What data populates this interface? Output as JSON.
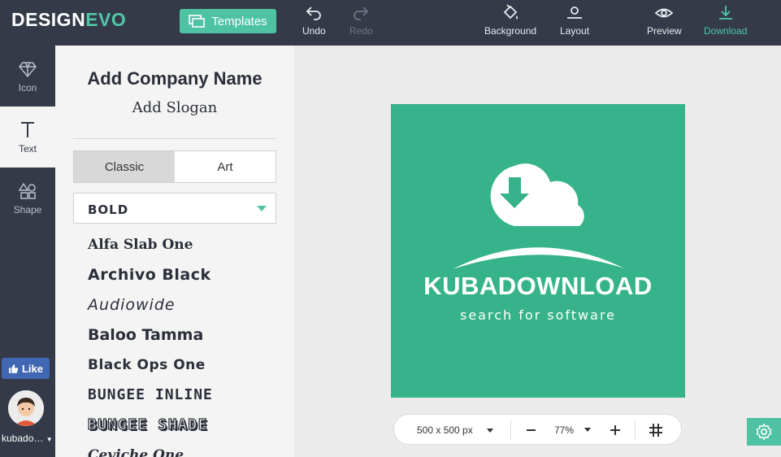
{
  "app": {
    "logo_main": "DESIGN",
    "logo_accent": "EVO"
  },
  "toolbar": {
    "templates_label": "Templates",
    "undo_label": "Undo",
    "redo_label": "Redo",
    "background_label": "Background",
    "layout_label": "Layout",
    "preview_label": "Preview",
    "download_label": "Download"
  },
  "sidebar": {
    "items": [
      {
        "label": "Icon",
        "icon": "diamond-icon"
      },
      {
        "label": "Text",
        "icon": "text-icon"
      },
      {
        "label": "Shape",
        "icon": "shapes-icon"
      }
    ],
    "active": "Text",
    "like_label": "Like",
    "user_name": "kubado…"
  },
  "text_panel": {
    "company_name": "Add Company Name",
    "slogan": "Add Slogan",
    "tabs": [
      {
        "label": "Classic",
        "selected": true
      },
      {
        "label": "Art",
        "selected": false
      }
    ],
    "font_category": "BOLD",
    "fonts": [
      "Alfa Slab One",
      "Archivo Black",
      "Audiowide",
      "Baloo Tamma",
      "Black Ops One",
      "BUNGEE INLINE",
      "BUNGEE SHADE",
      "Ceviche One"
    ]
  },
  "canvas": {
    "background_color": "#36b38a",
    "brand_name": "KUBADOWNLOAD",
    "tagline": "search for software",
    "size_label": "500 x 500 px",
    "zoom_label": "77%"
  },
  "colors": {
    "topbar": "#343a48",
    "accent": "#52c7a7",
    "facebook": "#4267b2"
  }
}
